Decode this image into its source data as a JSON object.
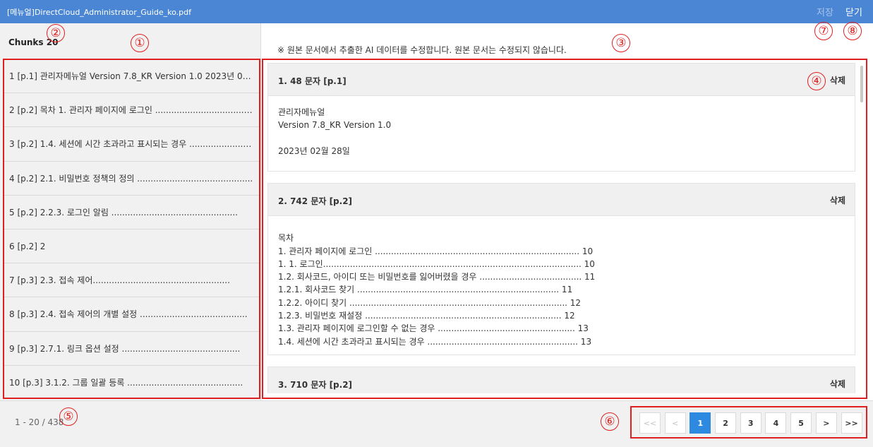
{
  "header": {
    "title": "[메뉴얼]DirectCloud_Administrator_Guide_ko.pdf",
    "save_label": "저장",
    "close_label": "닫기"
  },
  "sidebar": {
    "chunks_label": "Chunks 20",
    "items": [
      {
        "label": "1 [p.1] 관리자메뉴얼 Version 7.8_KR Version 1.0 2023년 02월 28..."
      },
      {
        "label": "2 [p.2] 목차 1. 관리자 페이지에 로그인 ........................................."
      },
      {
        "label": "3 [p.2] 1.4. 세션에 시간 초과라고 표시되는 경우 ..............................."
      },
      {
        "label": "4 [p.2] 2.1. 비밀번호 정책의 정의 ..........................................."
      },
      {
        "label": "5 [p.2] 2.2.3. 로그인 알림 ..............................................."
      },
      {
        "label": "6 [p.2] 2"
      },
      {
        "label": "7 [p.3] 2.3. 접속 제어..................................................."
      },
      {
        "label": "8 [p.3] 2.4. 접속 제어의 개별 설정 ........................................"
      },
      {
        "label": "9 [p.3] 2.7.1. 링크 옵션 설정 ............................................"
      },
      {
        "label": "10 [p.3] 3.1.2. 그룹 일괄 등록 ..........................................."
      }
    ]
  },
  "main": {
    "notice": "※ 원본 문서에서 추출한 AI 데이터를 수정합니다. 원본 문서는 수정되지 않습니다.",
    "delete_label": "삭제",
    "cards": [
      {
        "title": "1. 48 문자 [p.1]",
        "lines": [
          "관리자메뉴얼",
          "Version 7.8_KR Version 1.0",
          "",
          "2023년 02월 28일"
        ]
      },
      {
        "title": "2. 742 문자 [p.2]",
        "lines": [
          "",
          "목차",
          "1. 관리자 페이지에 로그인 ............................................................................ 10",
          "1. 1. 로그인................................................................................................ 10",
          "1.2. 회사코드, 아이디 또는 비밀번호를 잃어버렸을 경우 ...................................... 11",
          "1.2.1. 회사코드 찾기 ........................................................................... 11",
          "1.2.2. 아이디 찾기 ................................................................................. 12",
          "1.2.3. 비밀번호 재설정 ......................................................................... 12",
          "1.3. 관리자 페이지에 로그인할 수 없는 경우 ................................................... 13",
          "1.4. 세션에 시간 초과라고 표시되는 경우 ........................................................ 13"
        ]
      },
      {
        "title": "3. 710 문자 [p.2]",
        "lines": []
      }
    ]
  },
  "footer": {
    "range": "1 - 20 / 438",
    "pagination": {
      "first": "<<",
      "prev": "<",
      "pages": [
        "1",
        "2",
        "3",
        "4",
        "5"
      ],
      "next": ">",
      "last": ">>"
    }
  },
  "annotations": [
    "①",
    "②",
    "③",
    "④",
    "⑤",
    "⑥",
    "⑦",
    "⑧"
  ],
  "colors": {
    "header_bg": "#4a86d4",
    "active_page": "#2d8ae0",
    "annotation": "#e02020"
  }
}
